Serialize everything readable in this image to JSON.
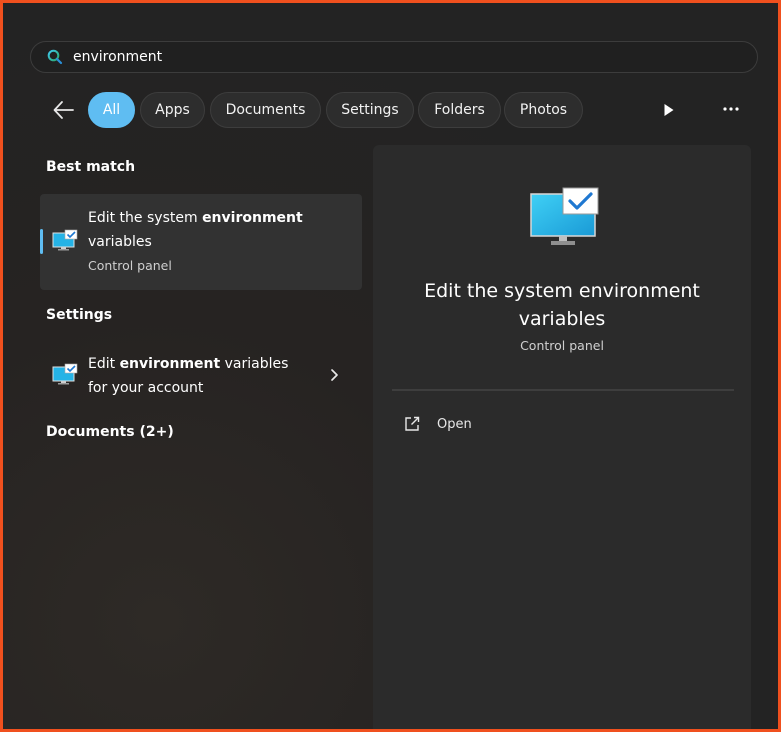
{
  "search": {
    "value": "environment",
    "icon": "search-icon"
  },
  "filters": {
    "back_icon": "back-arrow-icon",
    "tabs": [
      {
        "label": "All",
        "active": true
      },
      {
        "label": "Apps"
      },
      {
        "label": "Documents"
      },
      {
        "label": "Settings"
      },
      {
        "label": "Folders"
      },
      {
        "label": "Photos"
      }
    ],
    "play_icon": "play-icon",
    "more_icon": "more-icon"
  },
  "results": {
    "best_match": {
      "heading": "Best match",
      "item": {
        "title_prefix": "Edit the system ",
        "title_bold": "environment",
        "title_line2": "variables",
        "subtitle": "Control panel",
        "icon": "system-properties-icon"
      }
    },
    "settings": {
      "heading": "Settings",
      "item": {
        "title_prefix": "Edit ",
        "title_bold": "environment",
        "title_suffix": " variables",
        "title_line2": "for your account",
        "icon": "system-properties-icon"
      }
    },
    "documents": {
      "heading": "Documents (2+)"
    }
  },
  "detail": {
    "title": "Edit the system environment variables",
    "subtitle": "Control panel",
    "actions": [
      {
        "label": "Open",
        "icon": "open-external-icon"
      }
    ]
  },
  "colors": {
    "accent": "#5fbdf2",
    "frame_border": "#f0501e",
    "panel": "#2b2b2b",
    "background": "#232323"
  }
}
